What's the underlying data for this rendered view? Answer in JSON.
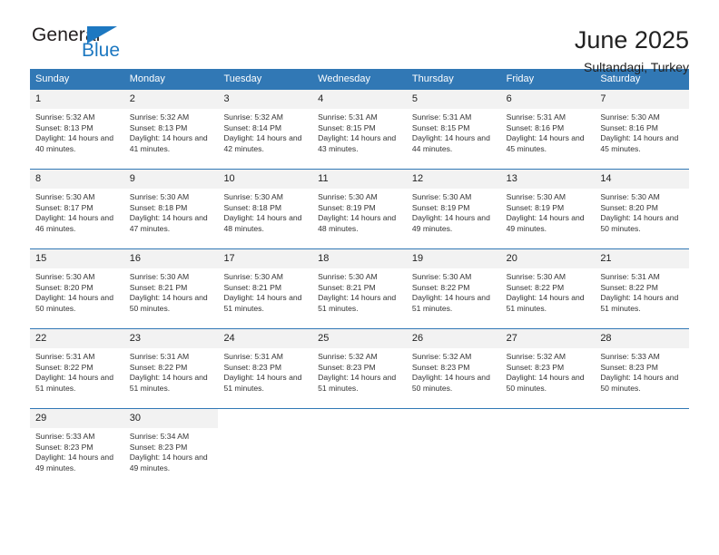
{
  "logo": {
    "word_one": "General",
    "word_two": "Blue",
    "flag_icon": "blue-triangle-flag",
    "brand_blue": "#1d78c1"
  },
  "header": {
    "title": "June 2025",
    "subtitle": "Sultandagi, Turkey"
  },
  "colors": {
    "header_blue": "#3178b5",
    "day_band_gray": "#f2f2f2",
    "text": "#222222"
  },
  "calendar": {
    "weekday_headers": [
      "Sunday",
      "Monday",
      "Tuesday",
      "Wednesday",
      "Thursday",
      "Friday",
      "Saturday"
    ],
    "weeks": [
      [
        {
          "day": "1",
          "sunrise": "Sunrise: 5:32 AM",
          "sunset": "Sunset: 8:13 PM",
          "daylight": "Daylight: 14 hours and 40 minutes."
        },
        {
          "day": "2",
          "sunrise": "Sunrise: 5:32 AM",
          "sunset": "Sunset: 8:13 PM",
          "daylight": "Daylight: 14 hours and 41 minutes."
        },
        {
          "day": "3",
          "sunrise": "Sunrise: 5:32 AM",
          "sunset": "Sunset: 8:14 PM",
          "daylight": "Daylight: 14 hours and 42 minutes."
        },
        {
          "day": "4",
          "sunrise": "Sunrise: 5:31 AM",
          "sunset": "Sunset: 8:15 PM",
          "daylight": "Daylight: 14 hours and 43 minutes."
        },
        {
          "day": "5",
          "sunrise": "Sunrise: 5:31 AM",
          "sunset": "Sunset: 8:15 PM",
          "daylight": "Daylight: 14 hours and 44 minutes."
        },
        {
          "day": "6",
          "sunrise": "Sunrise: 5:31 AM",
          "sunset": "Sunset: 8:16 PM",
          "daylight": "Daylight: 14 hours and 45 minutes."
        },
        {
          "day": "7",
          "sunrise": "Sunrise: 5:30 AM",
          "sunset": "Sunset: 8:16 PM",
          "daylight": "Daylight: 14 hours and 45 minutes."
        }
      ],
      [
        {
          "day": "8",
          "sunrise": "Sunrise: 5:30 AM",
          "sunset": "Sunset: 8:17 PM",
          "daylight": "Daylight: 14 hours and 46 minutes."
        },
        {
          "day": "9",
          "sunrise": "Sunrise: 5:30 AM",
          "sunset": "Sunset: 8:18 PM",
          "daylight": "Daylight: 14 hours and 47 minutes."
        },
        {
          "day": "10",
          "sunrise": "Sunrise: 5:30 AM",
          "sunset": "Sunset: 8:18 PM",
          "daylight": "Daylight: 14 hours and 48 minutes."
        },
        {
          "day": "11",
          "sunrise": "Sunrise: 5:30 AM",
          "sunset": "Sunset: 8:19 PM",
          "daylight": "Daylight: 14 hours and 48 minutes."
        },
        {
          "day": "12",
          "sunrise": "Sunrise: 5:30 AM",
          "sunset": "Sunset: 8:19 PM",
          "daylight": "Daylight: 14 hours and 49 minutes."
        },
        {
          "day": "13",
          "sunrise": "Sunrise: 5:30 AM",
          "sunset": "Sunset: 8:19 PM",
          "daylight": "Daylight: 14 hours and 49 minutes."
        },
        {
          "day": "14",
          "sunrise": "Sunrise: 5:30 AM",
          "sunset": "Sunset: 8:20 PM",
          "daylight": "Daylight: 14 hours and 50 minutes."
        }
      ],
      [
        {
          "day": "15",
          "sunrise": "Sunrise: 5:30 AM",
          "sunset": "Sunset: 8:20 PM",
          "daylight": "Daylight: 14 hours and 50 minutes."
        },
        {
          "day": "16",
          "sunrise": "Sunrise: 5:30 AM",
          "sunset": "Sunset: 8:21 PM",
          "daylight": "Daylight: 14 hours and 50 minutes."
        },
        {
          "day": "17",
          "sunrise": "Sunrise: 5:30 AM",
          "sunset": "Sunset: 8:21 PM",
          "daylight": "Daylight: 14 hours and 51 minutes."
        },
        {
          "day": "18",
          "sunrise": "Sunrise: 5:30 AM",
          "sunset": "Sunset: 8:21 PM",
          "daylight": "Daylight: 14 hours and 51 minutes."
        },
        {
          "day": "19",
          "sunrise": "Sunrise: 5:30 AM",
          "sunset": "Sunset: 8:22 PM",
          "daylight": "Daylight: 14 hours and 51 minutes."
        },
        {
          "day": "20",
          "sunrise": "Sunrise: 5:30 AM",
          "sunset": "Sunset: 8:22 PM",
          "daylight": "Daylight: 14 hours and 51 minutes."
        },
        {
          "day": "21",
          "sunrise": "Sunrise: 5:31 AM",
          "sunset": "Sunset: 8:22 PM",
          "daylight": "Daylight: 14 hours and 51 minutes."
        }
      ],
      [
        {
          "day": "22",
          "sunrise": "Sunrise: 5:31 AM",
          "sunset": "Sunset: 8:22 PM",
          "daylight": "Daylight: 14 hours and 51 minutes."
        },
        {
          "day": "23",
          "sunrise": "Sunrise: 5:31 AM",
          "sunset": "Sunset: 8:22 PM",
          "daylight": "Daylight: 14 hours and 51 minutes."
        },
        {
          "day": "24",
          "sunrise": "Sunrise: 5:31 AM",
          "sunset": "Sunset: 8:23 PM",
          "daylight": "Daylight: 14 hours and 51 minutes."
        },
        {
          "day": "25",
          "sunrise": "Sunrise: 5:32 AM",
          "sunset": "Sunset: 8:23 PM",
          "daylight": "Daylight: 14 hours and 51 minutes."
        },
        {
          "day": "26",
          "sunrise": "Sunrise: 5:32 AM",
          "sunset": "Sunset: 8:23 PM",
          "daylight": "Daylight: 14 hours and 50 minutes."
        },
        {
          "day": "27",
          "sunrise": "Sunrise: 5:32 AM",
          "sunset": "Sunset: 8:23 PM",
          "daylight": "Daylight: 14 hours and 50 minutes."
        },
        {
          "day": "28",
          "sunrise": "Sunrise: 5:33 AM",
          "sunset": "Sunset: 8:23 PM",
          "daylight": "Daylight: 14 hours and 50 minutes."
        }
      ],
      [
        {
          "day": "29",
          "sunrise": "Sunrise: 5:33 AM",
          "sunset": "Sunset: 8:23 PM",
          "daylight": "Daylight: 14 hours and 49 minutes."
        },
        {
          "day": "30",
          "sunrise": "Sunrise: 5:34 AM",
          "sunset": "Sunset: 8:23 PM",
          "daylight": "Daylight: 14 hours and 49 minutes."
        },
        {
          "day": "",
          "sunrise": "",
          "sunset": "",
          "daylight": ""
        },
        {
          "day": "",
          "sunrise": "",
          "sunset": "",
          "daylight": ""
        },
        {
          "day": "",
          "sunrise": "",
          "sunset": "",
          "daylight": ""
        },
        {
          "day": "",
          "sunrise": "",
          "sunset": "",
          "daylight": ""
        },
        {
          "day": "",
          "sunrise": "",
          "sunset": "",
          "daylight": ""
        }
      ]
    ]
  }
}
